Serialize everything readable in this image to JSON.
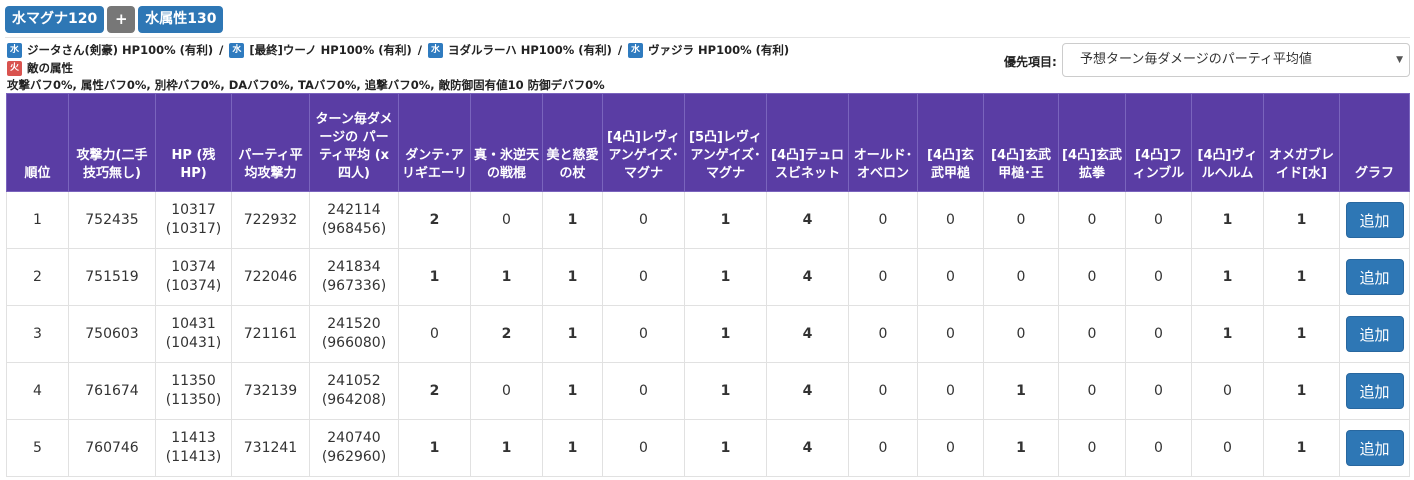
{
  "header": {
    "badge_magna": "水マグナ120",
    "badge_plus": "+",
    "badge_attr": "水属性130"
  },
  "party": {
    "element_label": "水",
    "members": [
      "ジータさん(剣豪) HP100% (有利)",
      "[最終]ウーノ HP100% (有利)",
      "ヨダルラーハ HP100% (有利)",
      "ヴァジラ HP100% (有利)"
    ],
    "separator": "/",
    "enemy_element_label": "火",
    "enemy_text": "敵の属性",
    "buff_text": "攻撃バフ0%, 属性バフ0%, 別枠バフ0%, DAバフ0%, TAバフ0%, 追撃バフ0%, 敵防御固有値10 防御デバフ0%"
  },
  "priority": {
    "label": "優先項目:",
    "selected": "予想ターン毎ダメージのパーティ平均値"
  },
  "colors": {
    "header_bg": "#5a3da4",
    "accent_blue": "#2e77b5",
    "water": "#2f7bbf",
    "fire": "#d9534f",
    "bold_count": "#1f5d8d"
  },
  "table": {
    "headers": [
      "順位",
      "攻撃力(二手技巧無し)",
      "HP (残HP)",
      "パーティ平均攻撃力",
      "ターン毎ダメージの パーティ平均 (x四人)",
      "ダンテ･アリギエーリ",
      "真・氷逆天の戦棍",
      "美と慈愛の杖",
      "[4凸]レヴィアンゲイズ･マグナ",
      "[5凸]レヴィアンゲイズ･マグナ",
      "[4凸]テュロスビネット",
      "オールド･オベロン",
      "[4凸]玄武甲槌",
      "[4凸]玄武甲槌･王",
      "[4凸]玄武拡拳",
      "[4凸]フィンブル",
      "[4凸]ヴィルヘルム",
      "オメガブレイド[水]",
      "グラフ"
    ],
    "add_label": "追加",
    "rows": [
      {
        "rank": "1",
        "atk": "752435",
        "hp": "10317",
        "hp_rem": "(10317)",
        "avg_atk": "722932",
        "dmg": "242114",
        "dmg_x4": "(968456)",
        "counts": [
          "2",
          "0",
          "1",
          "0",
          "1",
          "4",
          "0",
          "0",
          "0",
          "0",
          "0",
          "1",
          "1"
        ]
      },
      {
        "rank": "2",
        "atk": "751519",
        "hp": "10374",
        "hp_rem": "(10374)",
        "avg_atk": "722046",
        "dmg": "241834",
        "dmg_x4": "(967336)",
        "counts": [
          "1",
          "1",
          "1",
          "0",
          "1",
          "4",
          "0",
          "0",
          "0",
          "0",
          "0",
          "1",
          "1"
        ]
      },
      {
        "rank": "3",
        "atk": "750603",
        "hp": "10431",
        "hp_rem": "(10431)",
        "avg_atk": "721161",
        "dmg": "241520",
        "dmg_x4": "(966080)",
        "counts": [
          "0",
          "2",
          "1",
          "0",
          "1",
          "4",
          "0",
          "0",
          "0",
          "0",
          "0",
          "1",
          "1"
        ]
      },
      {
        "rank": "4",
        "atk": "761674",
        "hp": "11350",
        "hp_rem": "(11350)",
        "avg_atk": "732139",
        "dmg": "241052",
        "dmg_x4": "(964208)",
        "counts": [
          "2",
          "0",
          "1",
          "0",
          "1",
          "4",
          "0",
          "0",
          "1",
          "0",
          "0",
          "0",
          "1"
        ]
      },
      {
        "rank": "5",
        "atk": "760746",
        "hp": "11413",
        "hp_rem": "(11413)",
        "avg_atk": "731241",
        "dmg": "240740",
        "dmg_x4": "(962960)",
        "counts": [
          "1",
          "1",
          "1",
          "0",
          "1",
          "4",
          "0",
          "0",
          "1",
          "0",
          "0",
          "0",
          "1"
        ]
      }
    ]
  }
}
